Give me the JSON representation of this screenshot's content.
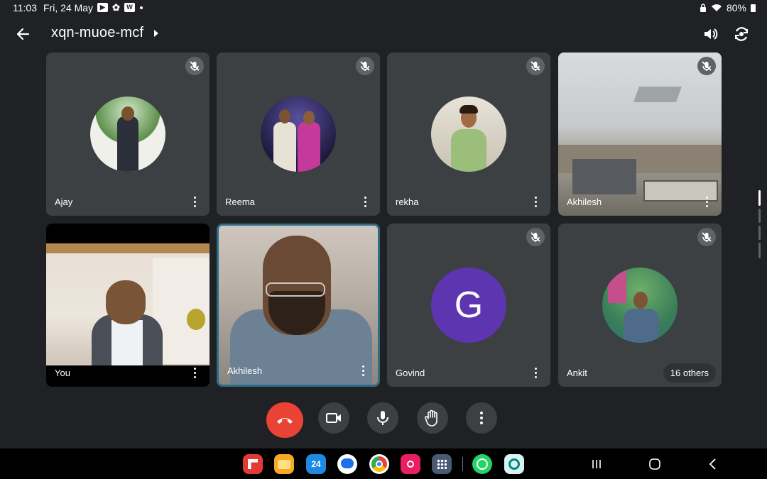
{
  "status_bar": {
    "time": "11:03",
    "date": "Fri, 24 May",
    "battery": "80%",
    "icons": [
      "youtube-icon",
      "settings-icon",
      "w-app-icon"
    ]
  },
  "meeting": {
    "code": "xqn-muoe-mcf"
  },
  "participants": [
    {
      "name": "Ajay",
      "muted": true
    },
    {
      "name": "Reema",
      "muted": true
    },
    {
      "name": "rekha",
      "muted": true
    },
    {
      "name": "Akhilesh",
      "muted": true
    },
    {
      "name": "You",
      "muted": false
    },
    {
      "name": "Akhilesh",
      "muted": false
    },
    {
      "name": "Govind",
      "muted": true,
      "initial": "G"
    },
    {
      "name": "Ankit",
      "muted": true
    }
  ],
  "others_count_label": "16 others",
  "dock_date": "24",
  "colors": {
    "background": "#202124",
    "tile": "#3c4043",
    "end_call": "#ea4335",
    "govind_avatar": "#5e35b1",
    "active_speaker_border": "#2e6d85"
  }
}
